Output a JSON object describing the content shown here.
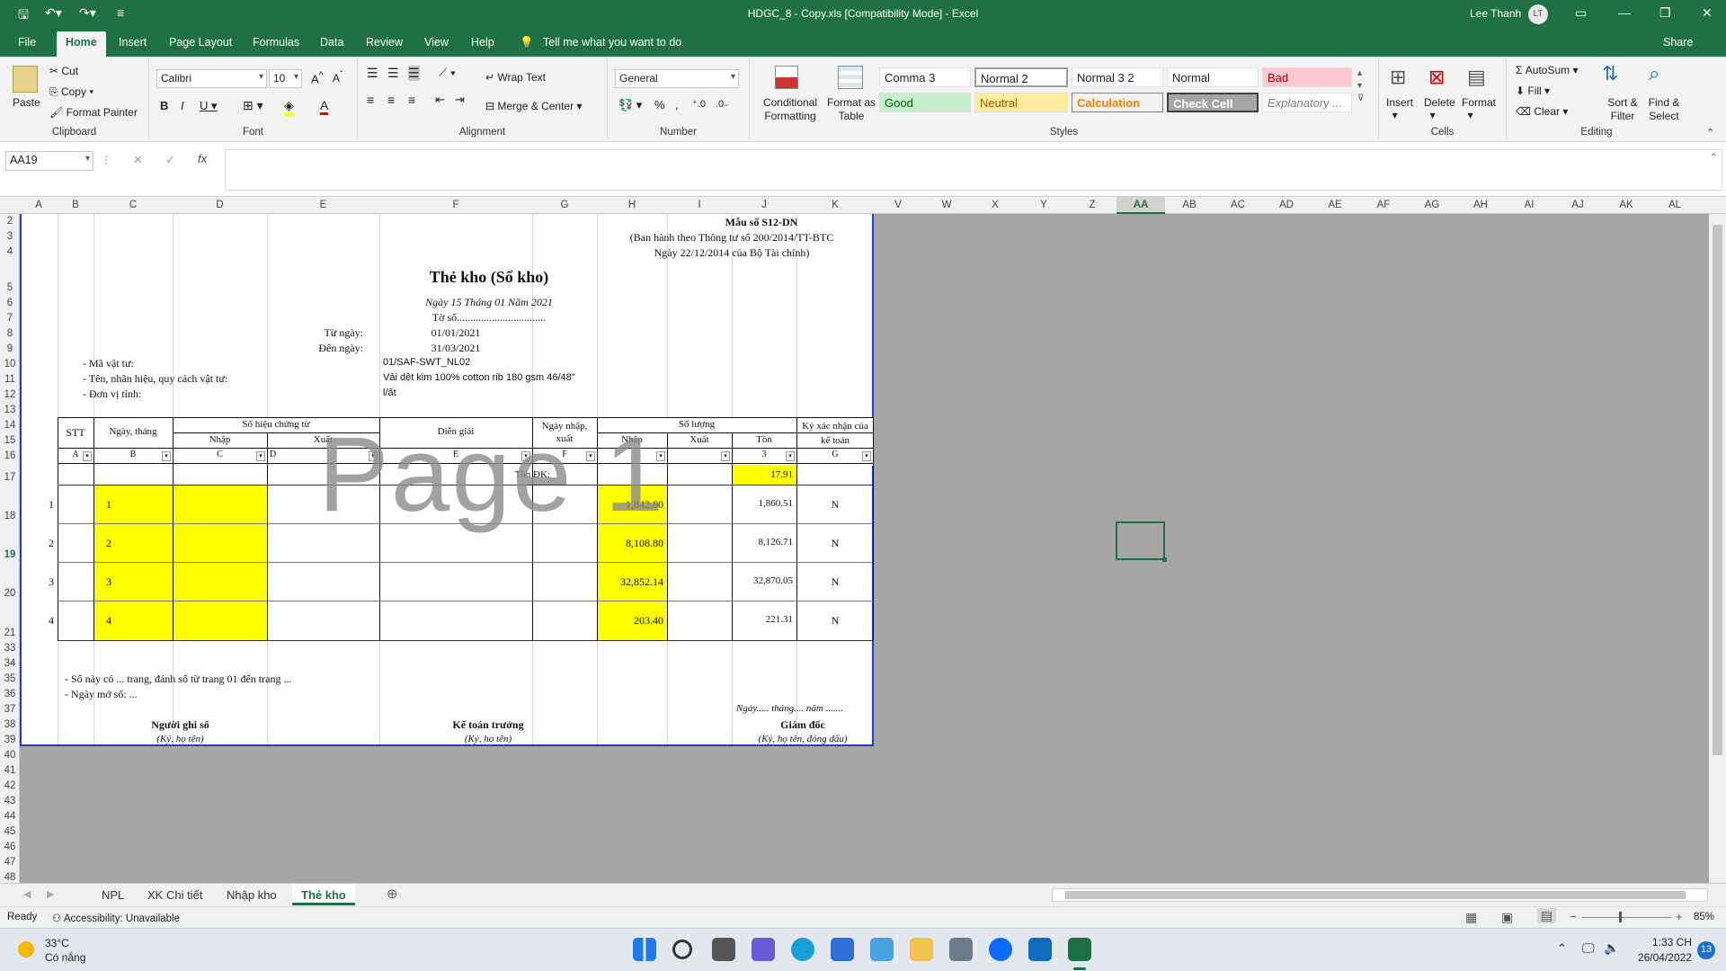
{
  "window": {
    "title": "HDGC_8 - Copy.xls  [Compatibility Mode]  -  Excel",
    "user": "Lee Thanh",
    "user_initials": "LT"
  },
  "ribbon_tabs": [
    "File",
    "Home",
    "Insert",
    "Page Layout",
    "Formulas",
    "Data",
    "Review",
    "View",
    "Help"
  ],
  "tell_me": "Tell me what you want to do",
  "share": "Share",
  "clipboard": {
    "paste": "Paste",
    "cut": "Cut",
    "copy": "Copy",
    "format_painter": "Format Painter",
    "label": "Clipboard"
  },
  "font": {
    "name": "Calibri",
    "size": "10",
    "label": "Font"
  },
  "alignment": {
    "wrap": "Wrap Text",
    "merge": "Merge & Center",
    "label": "Alignment"
  },
  "number": {
    "format": "General",
    "label": "Number"
  },
  "styles": {
    "cond": "Conditional Formatting",
    "fmt_table": "Format as Table",
    "cells": [
      "Comma 3",
      "Normal 2",
      "Normal 3 2",
      "Normal",
      "Bad",
      "Good",
      "Neutral",
      "Calculation",
      "Check Cell",
      "Explanatory ..."
    ],
    "label": "Styles"
  },
  "cells_grp": {
    "insert": "Insert",
    "delete": "Delete",
    "format": "Format",
    "label": "Cells"
  },
  "editing": {
    "autosum": "AutoSum",
    "fill": "Fill",
    "clear": "Clear",
    "sort": "Sort & Filter",
    "find": "Find & Select",
    "label": "Editing"
  },
  "namebox": "AA19",
  "columns": [
    "A",
    "B",
    "C",
    "D",
    "E",
    "F",
    "G",
    "H",
    "I",
    "J",
    "K",
    "V",
    "W",
    "X",
    "Y",
    "Z",
    "AA",
    "AB",
    "AC",
    "AD",
    "AE",
    "AF",
    "AG",
    "AH",
    "AI",
    "AJ",
    "AK",
    "AL"
  ],
  "rows": [
    "2",
    "3",
    "4",
    "5",
    "6",
    "7",
    "8",
    "9",
    "10",
    "11",
    "12",
    "13",
    "14",
    "15",
    "16",
    "17",
    "18",
    "19",
    "20",
    "21",
    "33",
    "34",
    "35",
    "36",
    "37",
    "38",
    "39",
    "40",
    "41",
    "42",
    "43",
    "44",
    "45",
    "46",
    "47",
    "48"
  ],
  "sheet": {
    "form_no": "Mẫu số S12-DN",
    "form_basis": "(Ban hành theo Thông tư số 200/2014/TT-BTC",
    "form_date": "Ngày 22/12/2014 của Bộ Tài chính)",
    "title": "Thẻ kho (Sổ kho)",
    "date_line": "Ngày 15 Tháng 01 Năm 2021",
    "to_so": "Tờ số.................................",
    "tu_ngay_label": "Từ  ngày:",
    "tu_ngay": "01/01/2021",
    "den_ngay_label": "Đến ngày:",
    "den_ngay": "31/03/2021",
    "ma_vt_label": "- Mã vật tư:",
    "ma_vt": "01/SAF-SWT_NL02",
    "ten_label": "- Tên, nhãn hiệu, quy cách vật tư:",
    "ten": "Vải dệt kim 100% cotton rib 180 gsm 46/48\"",
    "dvt_label": "- Đơn vị tính:",
    "dvt": "l/ất",
    "h_stt": "STT",
    "h_ngay": "Ngày, tháng",
    "h_so_hieu": "Số hiệu chứng từ",
    "h_nhap": "Nhập",
    "h_xuat": "Xuất",
    "h_dien_giai": "Diễn giải",
    "h_ngay_nx": "Ngày nhập, xuất",
    "h_so_luong": "Số lượng",
    "h_sl_nhap": "Nhập",
    "h_sl_xuat": "Xuất",
    "h_ton": "Tồn",
    "h_ky": "Ký xác nhận của kế toán",
    "codes": [
      "A",
      "B",
      "C",
      "D",
      "E",
      "F",
      "",
      "",
      "3",
      "G"
    ],
    "ton_dk_label": "Tồn ĐK:",
    "ton_dk": "17.91",
    "rows": [
      {
        "stt": "1",
        "ngay": "1",
        "nhap": "1,842.60",
        "ton": "1,860.51",
        "ky": "N"
      },
      {
        "stt": "2",
        "ngay": "2",
        "nhap": "8,108.80",
        "ton": "8,126.71",
        "ky": "N"
      },
      {
        "stt": "3",
        "ngay": "3",
        "nhap": "32,852.14",
        "ton": "32,870.05",
        "ky": "N"
      },
      {
        "stt": "4",
        "ngay": "4",
        "nhap": "203.40",
        "ton": "221.31",
        "ky": "N"
      }
    ],
    "foot1": "- Sổ này có ... trang, đánh số từ trang 01 đến trang ...",
    "foot2": "- Ngày mở sổ: ...",
    "foot_date": "Ngày..... tháng.... năm .......",
    "sig1": "Người ghi sổ",
    "sig1s": "(Ký, họ tên)",
    "sig2": "Kế toán trưởng",
    "sig2s": "(Ký, họ tên)",
    "sig3": "Giám đốc",
    "sig3s": "(Ký, họ tên, đóng dấu)",
    "watermark": "Page 1"
  },
  "sheet_tabs": [
    "NPL",
    "XK Chi tiết",
    "Nhập kho",
    "Thẻ kho"
  ],
  "status": {
    "ready": "Ready",
    "accessibility": "Accessibility: Unavailable",
    "zoom": "85%"
  },
  "taskbar": {
    "temp": "33°C",
    "weather": "Có nắng",
    "time": "1:33 CH",
    "date": "26/04/2022",
    "badge": "13"
  }
}
